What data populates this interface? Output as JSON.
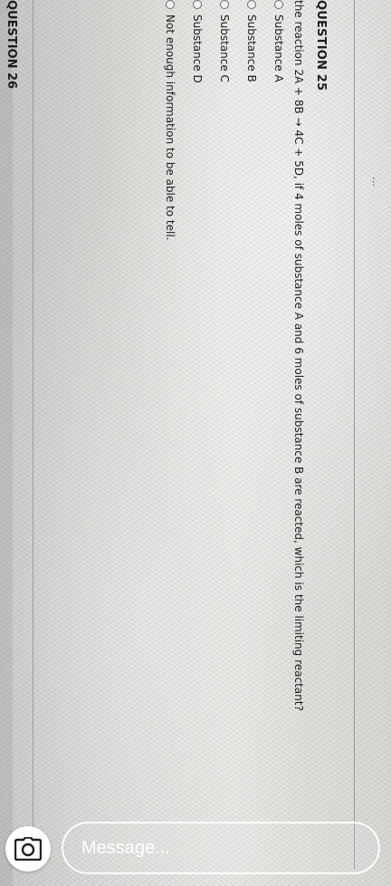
{
  "document": {
    "partial_header": "…",
    "question25": {
      "title": "QUESTION 25",
      "text": "the reaction 2A + 8B → 4C + 5D, if 4 moles of substance A and 6 moles of substance B are reacted, which is  the limiting reactant?",
      "options": [
        "Substance A",
        "Substance B",
        "Substance C",
        "Substance D",
        "Not enough information to be able to tell."
      ]
    },
    "question26": {
      "title": "QUESTION 26"
    }
  },
  "message_bar": {
    "placeholder": "Message..."
  },
  "icons": {
    "camera": "camera-icon",
    "radio": "radio-unselected-icon"
  },
  "colors": {
    "message_bar_border": "#ffffff",
    "camera_button_bg": "#ffffff"
  }
}
